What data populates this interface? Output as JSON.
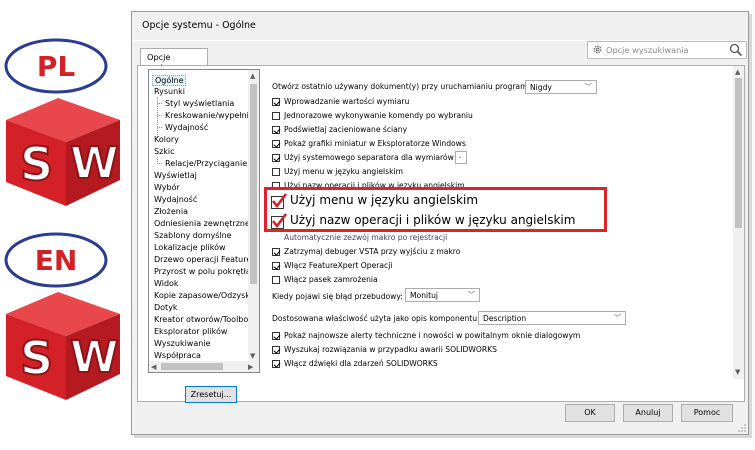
{
  "logos": {
    "top_label": "PL",
    "bottom_label": "EN",
    "letters": [
      "S",
      "W"
    ],
    "colors": {
      "red": "#d42027",
      "dark_red": "#8b1418",
      "blue": "#2a3d8f"
    }
  },
  "dialog": {
    "title": "Opcje systemu - Ogólne",
    "tab": "Opcje systemu",
    "search_placeholder": "Opcje wyszukiwania",
    "reset_button": "Zresetuj...",
    "buttons": {
      "ok": "OK",
      "cancel": "Anuluj",
      "help": "Pomoc"
    }
  },
  "tree": [
    {
      "label": "Ogólne",
      "selected": true,
      "level": 0
    },
    {
      "label": "Rysunki",
      "level": 0
    },
    {
      "label": "Styl wyświetlania",
      "level": 1
    },
    {
      "label": "Kreskowanie/wypełnienie obszaru",
      "level": 1
    },
    {
      "label": "Wydajność",
      "level": 1
    },
    {
      "label": "Kolory",
      "level": 0
    },
    {
      "label": "Szkic",
      "level": 0
    },
    {
      "label": "Relacje/Przyciąganie",
      "level": 1
    },
    {
      "label": "Wyświetlaj",
      "level": 0
    },
    {
      "label": "Wybór",
      "level": 0
    },
    {
      "label": "Wydajność",
      "level": 0
    },
    {
      "label": "Złożenia",
      "level": 0
    },
    {
      "label": "Odniesienia zewnętrzne",
      "level": 0
    },
    {
      "label": "Szablony domyślne",
      "level": 0
    },
    {
      "label": "Lokalizacje plików",
      "level": 0
    },
    {
      "label": "Drzewo operacji FeatureManager",
      "level": 0
    },
    {
      "label": "Przyrost w polu pokrętła",
      "level": 0
    },
    {
      "label": "Widok",
      "level": 0
    },
    {
      "label": "Kopie zapasowe/Odzyskaj",
      "level": 0
    },
    {
      "label": "Dotyk",
      "level": 0
    },
    {
      "label": "Kreator otworów/Toolbox",
      "level": 0
    },
    {
      "label": "Eksplorator plików",
      "level": 0
    },
    {
      "label": "Wyszukiwanie",
      "level": 0
    },
    {
      "label": "Współpraca",
      "level": 0
    }
  ],
  "options": {
    "open_recent_label": "Otwórz ostatnio używany dokument(y) przy uruchamianiu programu:",
    "open_recent_value": "Nigdy",
    "items_top": [
      {
        "label": "Wprowadzanie wartości wymiaru",
        "checked": true
      },
      {
        "label": "Jednorazowe wykonywanie komendy po wybraniu",
        "checked": false
      },
      {
        "label": "Podświetlaj zacieniowane ściany",
        "checked": true
      },
      {
        "label": "Pokaż grafiki miniatur w Eksploratorze Windows",
        "checked": true
      },
      {
        "label": "Użyj systemowego separatora dla wymiarów",
        "checked": true
      },
      {
        "label": "Użyj menu w języku angielskim",
        "checked": false
      },
      {
        "label": "Użyj nazw operacji i plików w języku angielskim",
        "checked": false
      }
    ],
    "separator_value": ".",
    "partial_hidden": "Automatycznie zezwój makro po rejestracji",
    "items_mid": [
      {
        "label": "Zatrzymaj debuger VSTA przy wyjściu z makro",
        "checked": true
      },
      {
        "label": "Włącz FeatureXpert Operacji",
        "checked": true
      },
      {
        "label": "Włącz pasek zamrożenia",
        "checked": false
      }
    ],
    "error_label": "Kiedy pojawi się błąd przebudowy:",
    "error_value": "Monituj",
    "custom_prop_label": "Dostosowana właściwość użyta jako opis komponentu:",
    "custom_prop_value": "Description",
    "items_bottom": [
      {
        "label": "Pokaż najnowsze alerty techniczne i nowości w powitalnym oknie dialogowym",
        "checked": true
      },
      {
        "label": "Wyszukaj rozwiązania w przypadku awarii SOLIDWORKS",
        "checked": true
      },
      {
        "label": "Włącz dźwięki dla zdarzeń SOLIDWORKS",
        "checked": true
      }
    ]
  },
  "highlight": {
    "line1": "Użyj menu w języku angielskim",
    "line2": "Użyj nazw operacji i plików w języku angielskim",
    "border_color": "#e0232b"
  }
}
